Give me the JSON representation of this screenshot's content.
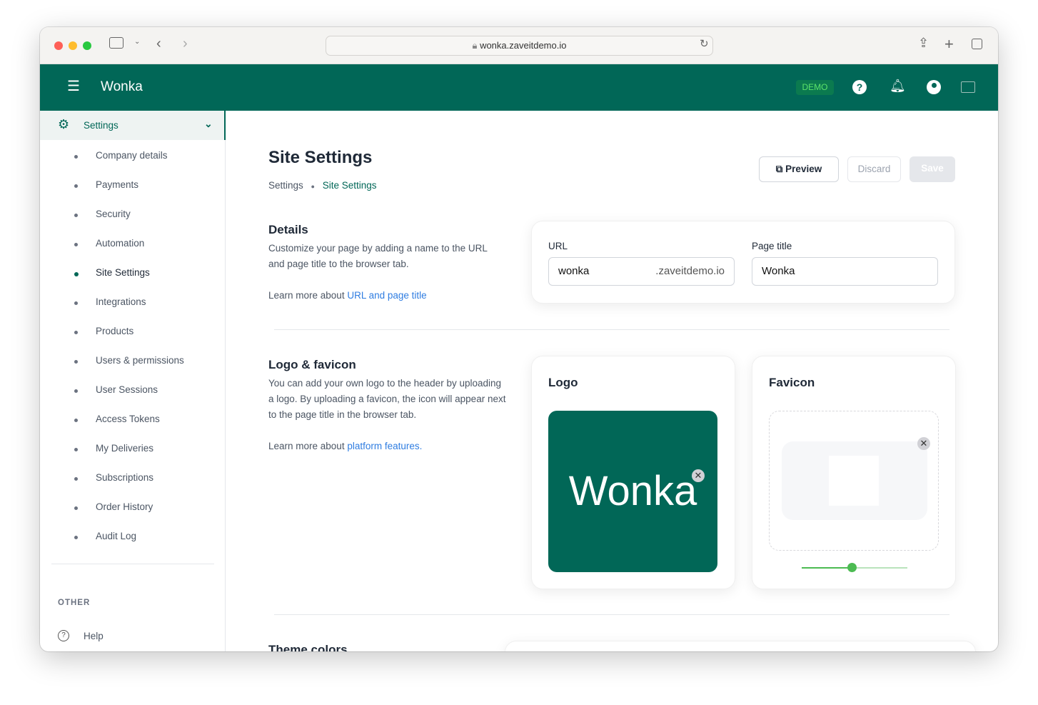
{
  "browser": {
    "url": "wonka.zaveitdemo.io"
  },
  "header": {
    "app_name": "Wonka",
    "badge": "DEMO"
  },
  "sidebar": {
    "section": "Settings",
    "items": [
      {
        "label": "Company details",
        "active": false
      },
      {
        "label": "Payments",
        "active": false
      },
      {
        "label": "Security",
        "active": false
      },
      {
        "label": "Automation",
        "active": false
      },
      {
        "label": "Site Settings",
        "active": true
      },
      {
        "label": "Integrations",
        "active": false
      },
      {
        "label": "Products",
        "active": false
      },
      {
        "label": "Users & permissions",
        "active": false
      },
      {
        "label": "User Sessions",
        "active": false
      },
      {
        "label": "Access Tokens",
        "active": false
      },
      {
        "label": "My Deliveries",
        "active": false
      },
      {
        "label": "Subscriptions",
        "active": false
      },
      {
        "label": "Order History",
        "active": false
      },
      {
        "label": "Audit Log",
        "active": false
      }
    ],
    "other_heading": "OTHER",
    "help": "Help"
  },
  "page": {
    "title": "Site Settings",
    "breadcrumb": [
      "Settings",
      "Site Settings"
    ],
    "preview": "Preview",
    "discard": "Discard",
    "save": "Save"
  },
  "details": {
    "title": "Details",
    "description": "Customize your page by adding a name to the URL and page title to the browser tab.",
    "learn_prefix": "Learn more about ",
    "learn_link": "URL and page title",
    "url_label": "URL",
    "url_value": "wonka",
    "url_suffix": ".zaveitdemo.io",
    "page_title_label": "Page title",
    "page_title_value": "Wonka"
  },
  "logo": {
    "title": "Logo & favicon",
    "description": "You can add your own logo to the header by uploading a logo. By uploading a favicon, the icon will appear next to the page title in the browser tab.",
    "learn_prefix": "Learn more about ",
    "learn_link": "platform features.",
    "logo_card": "Logo",
    "logo_text": "Wonka",
    "favicon_card": "Favicon",
    "favicon_zoom": 0.47
  },
  "theme": {
    "title": "Theme colors"
  },
  "colors": {
    "brand": "#016757",
    "accent": "#4cbb52",
    "link": "#2f7de1"
  }
}
